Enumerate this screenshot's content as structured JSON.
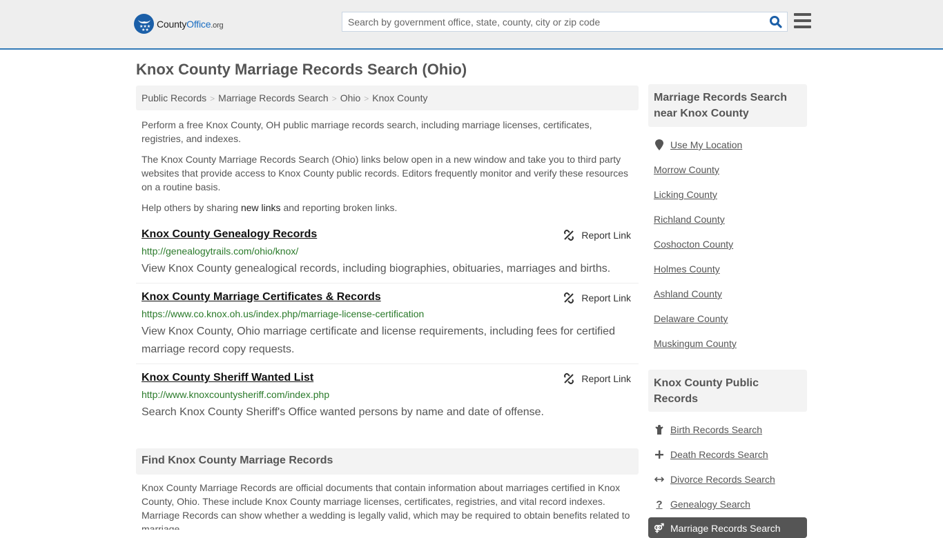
{
  "header": {
    "logo_main": "County",
    "logo_bold": "Office",
    "logo_suffix": ".org",
    "search_placeholder": "Search by government office, state, county, city or zip code",
    "search_value": "",
    "accent_color": "#337ab7"
  },
  "page": {
    "title": "Knox County Marriage Records Search (Ohio)"
  },
  "breadcrumb": [
    {
      "label": "Public Records"
    },
    {
      "label": "Marriage Records Search"
    },
    {
      "label": "Ohio"
    },
    {
      "label": "Knox County"
    }
  ],
  "intro": {
    "p1": "Perform a free Knox County, OH public marriage records search, including marriage licenses, certificates, registries, and indexes.",
    "p2": "The Knox County Marriage Records Search (Ohio) links below open in a new window and take you to third party websites that provide access to Knox County public records. Editors frequently monitor and verify these resources on a routine basis.",
    "p3_before": "Help others by sharing ",
    "p3_link": "new links",
    "p3_after": " and reporting broken links."
  },
  "results": [
    {
      "title": "Knox County Genealogy Records",
      "url": "http://genealogytrails.com/ohio/knox/",
      "description": "View Knox County genealogical records, including biographies, obituaries, marriages and births.",
      "report_label": "Report Link"
    },
    {
      "title": "Knox County Marriage Certificates & Records",
      "url": "https://www.co.knox.oh.us/index.php/marriage-license-certification",
      "description": "View Knox County, Ohio marriage certificate and license requirements, including fees for certified marriage record copy requests.",
      "report_label": "Report Link"
    },
    {
      "title": "Knox County Sheriff Wanted List",
      "url": "http://www.knoxcountysheriff.com/index.php",
      "description": "Search Knox County Sheriff's Office wanted persons by name and date of offense.",
      "report_label": "Report Link"
    }
  ],
  "find_section": {
    "heading": "Find Knox County Marriage Records",
    "body": "Knox County Marriage Records are official documents that contain information about marriages certified in Knox County, Ohio. These include Knox County marriage licenses, certificates, registries, and vital record indexes. Marriage Records can show whether a wedding is legally valid, which may be required to obtain benefits related to marriage."
  },
  "sidebar": {
    "nearby_heading": "Marriage Records Search near Knox County",
    "use_location": "Use My Location",
    "nearby": [
      "Morrow County",
      "Licking County",
      "Richland County",
      "Coshocton County",
      "Holmes County",
      "Ashland County",
      "Delaware County",
      "Muskingum County"
    ],
    "public_heading": "Knox County Public Records",
    "public_links": [
      {
        "label": "Birth Records Search",
        "icon": "child-icon"
      },
      {
        "label": "Death Records Search",
        "icon": "plus-icon"
      },
      {
        "label": "Divorce Records Search",
        "icon": "arrows-horizontal-icon"
      },
      {
        "label": "Genealogy Search",
        "icon": "question-icon"
      }
    ],
    "active_link": {
      "label": "Marriage Records Search",
      "icon": "marriage-icon"
    }
  }
}
